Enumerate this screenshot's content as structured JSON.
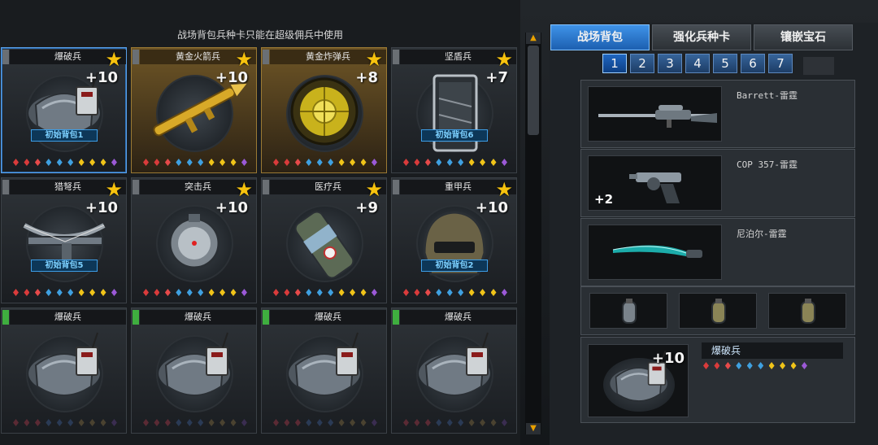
{
  "notice": "战场背包兵种卡只能在超级佣兵中使用",
  "cards": [
    {
      "name": "爆破兵",
      "plus": "+10",
      "bag": "初始背包1",
      "star": true,
      "flag": "gray",
      "kind": "backpack",
      "style": "sel",
      "gems": "color"
    },
    {
      "name": "黄金火箭兵",
      "plus": "+10",
      "bag": "",
      "star": true,
      "flag": "gray",
      "kind": "rocket",
      "style": "gold",
      "gems": "color"
    },
    {
      "name": "黄金炸弹兵",
      "plus": "+8",
      "bag": "",
      "star": true,
      "flag": "gray",
      "kind": "bomb",
      "style": "gold",
      "gems": "color"
    },
    {
      "name": "坚盾兵",
      "plus": "+7",
      "bag": "初始背包6",
      "star": true,
      "flag": "gray",
      "kind": "shield",
      "style": "",
      "gems": "color"
    },
    {
      "name": "猎弩兵",
      "plus": "+10",
      "bag": "初始背包5",
      "star": true,
      "flag": "gray",
      "kind": "crossbow",
      "style": "",
      "gems": "color"
    },
    {
      "name": "突击兵",
      "plus": "+10",
      "bag": "",
      "star": true,
      "flag": "gray",
      "kind": "mine",
      "style": "",
      "gems": "color"
    },
    {
      "name": "医疗兵",
      "plus": "+9",
      "bag": "",
      "star": true,
      "flag": "gray",
      "kind": "medic",
      "style": "",
      "gems": "color"
    },
    {
      "name": "重甲兵",
      "plus": "+10",
      "bag": "初始背包2",
      "star": true,
      "flag": "gray",
      "kind": "helmet",
      "style": "",
      "gems": "color"
    },
    {
      "name": "爆破兵",
      "plus": "",
      "bag": "",
      "star": false,
      "flag": "green",
      "kind": "backpack",
      "style": "",
      "gems": "dark"
    },
    {
      "name": "爆破兵",
      "plus": "",
      "bag": "",
      "star": false,
      "flag": "green",
      "kind": "backpack",
      "style": "",
      "gems": "dark"
    },
    {
      "name": "爆破兵",
      "plus": "",
      "bag": "",
      "star": false,
      "flag": "green",
      "kind": "backpack",
      "style": "",
      "gems": "dark"
    },
    {
      "name": "爆破兵",
      "plus": "",
      "bag": "",
      "star": false,
      "flag": "green",
      "kind": "backpack",
      "style": "",
      "gems": "dark"
    }
  ],
  "icons": {
    "star": "★",
    "scroll_up": "▲",
    "scroll_down": "▼"
  },
  "tabs": [
    {
      "label": "战场背包",
      "active": true
    },
    {
      "label": "强化兵种卡",
      "active": false
    },
    {
      "label": "镶嵌宝石",
      "active": false
    }
  ],
  "pages": [
    "1",
    "2",
    "3",
    "4",
    "5",
    "6",
    "7"
  ],
  "active_page": "1",
  "weapons": [
    {
      "name": "Barrett-雷霆",
      "kind": "sniper",
      "ammo": ""
    },
    {
      "name": "COP 357-雷霆",
      "kind": "pistol",
      "ammo": "+2"
    },
    {
      "name": "尼泊尔-雷霆",
      "kind": "knife",
      "ammo": ""
    }
  ],
  "grenades": [
    "grenade",
    "smoke",
    "flash"
  ],
  "equipped": {
    "name": "爆破兵",
    "plus": "+10",
    "kind": "backpack"
  },
  "gem_colors": [
    "#d93b3b",
    "#d93b3b",
    "#e64a4a",
    "#3fa0e0",
    "#3fa0e0",
    "#3fa0e0",
    "#f0c419",
    "#f0c419",
    "#f0c419",
    "#9b59d6"
  ],
  "dark_gem_colors": [
    "#5a2a34",
    "#5a2a34",
    "#5a2a34",
    "#2a3a55",
    "#2a3a55",
    "#2a3a55",
    "#4a4230",
    "#4a4230",
    "#4a4230",
    "#3a2d50"
  ]
}
